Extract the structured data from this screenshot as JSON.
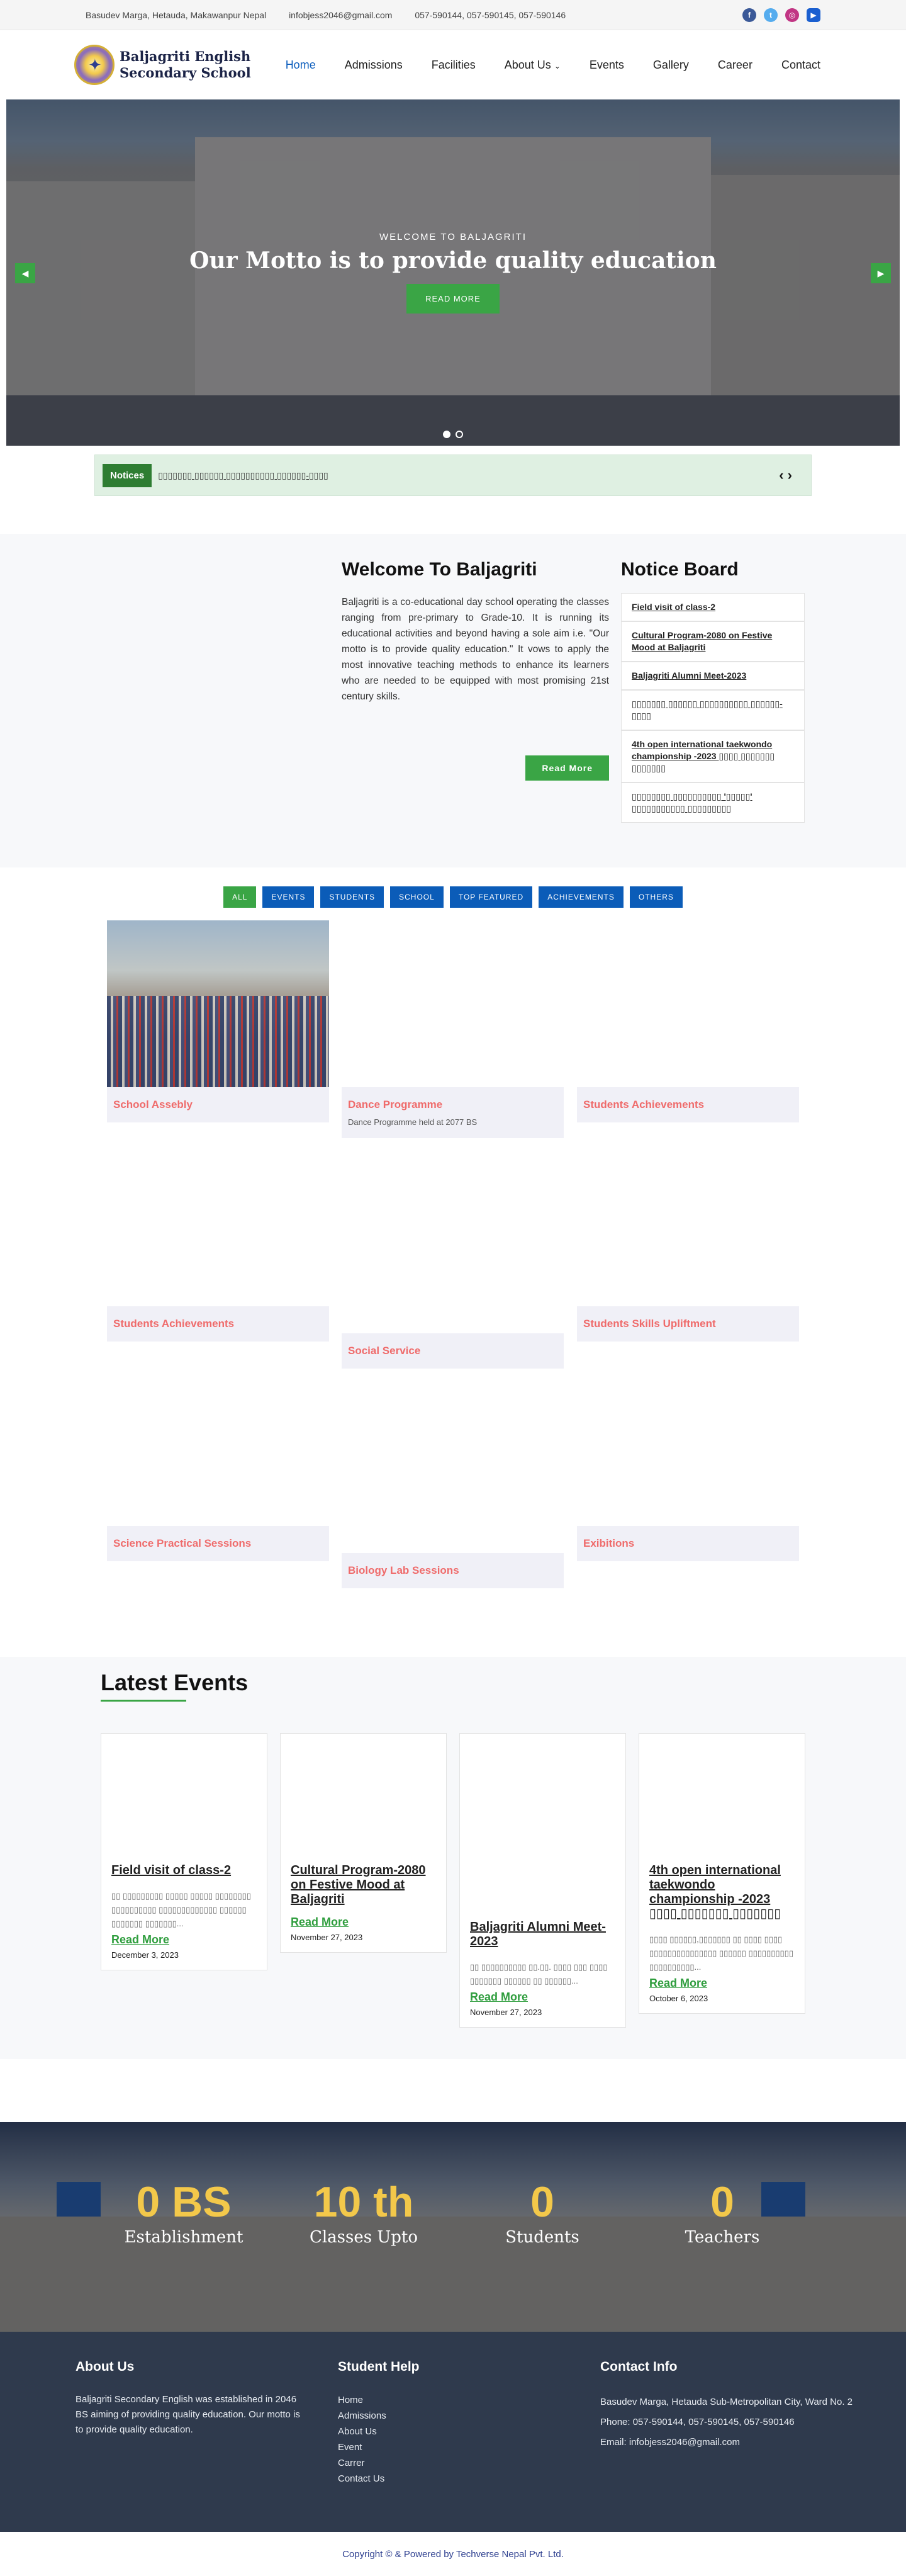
{
  "topbar": {
    "address": "Basudev Marga, Hetauda, Makawanpur Nepal",
    "email": "infobjess2046@gmail.com",
    "phone": "057-590144, 057-590145, 057-590146",
    "socials": [
      {
        "icon": "facebook-icon",
        "color": "#3b5998"
      },
      {
        "icon": "twitter-icon",
        "color": "#55acee"
      },
      {
        "icon": "instagram-icon",
        "color": "#c13584"
      },
      {
        "icon": "youtube-icon",
        "color": "#1a5fd0"
      }
    ]
  },
  "header": {
    "logo_line1": "Baljagriti English",
    "logo_line2": "Secondary School",
    "nav": [
      "Home",
      "Admissions",
      "Facilities",
      "About Us",
      "Events",
      "Gallery",
      "Career",
      "Contact"
    ]
  },
  "hero": {
    "subtitle": "WELCOME TO BALJAGRITI",
    "title": "Our Motto is to provide quality education",
    "button": "READ MORE",
    "prev_arrow": "◀",
    "next_arrow": "▶"
  },
  "notices": {
    "label": "Notices",
    "text": "▯▯▯▯▯▯▯ ▯▯▯▯▯▯ ▯▯▯▯▯▯▯▯▯▯ ▯▯▯▯▯▯-▯▯▯▯",
    "arrows": "‹ ›"
  },
  "welcome": {
    "title": "Welcome To Baljagriti",
    "body": "Baljagriti is a co-educational day school operating the classes ranging from pre-primary to Grade-10. It is running its educational activities and beyond having a sole aim i.e. \"Our motto is to provide quality education.\" It vows to apply the most innovative teaching methods to enhance its learners who are needed to be equipped with most promising 21st century skills.",
    "button": "Read More"
  },
  "notice_board": {
    "title": "Notice Board",
    "items": [
      "Field visit of class-2",
      "Cultural Program-2080 on Festive Mood at Baljagriti",
      "Baljagriti Alumni Meet-2023",
      "▯▯▯▯▯▯▯ ▯▯▯▯▯▯ ▯▯▯▯▯▯▯▯▯▯ ▯▯▯▯▯▯-▯▯▯▯",
      "4th open international taekwondo championship -2023 ▯▯▯▯ ▯▯▯▯▯▯▯ ▯▯▯▯▯▯▯",
      "▯▯▯▯▯▯▯▯ ▯▯▯▯▯▯▯▯▯▯ '▯▯▯▯▯' ▯▯▯▯▯▯▯▯▯▯▯ ▯▯▯▯▯▯▯▯▯"
    ]
  },
  "filters": [
    "ALL",
    "EVENTS",
    "STUDENTS",
    "SCHOOL",
    "TOP FEATURED",
    "ACHIEVEMENTS",
    "OTHERS"
  ],
  "gallery": [
    {
      "title": "School Assebly",
      "desc": ""
    },
    {
      "title": "Dance Programme",
      "desc": "Dance Programme held at 2077 BS"
    },
    {
      "title": "Students Achievements",
      "desc": ""
    },
    {
      "title": "Students Achievements",
      "desc": ""
    },
    {
      "title": "Social Service",
      "desc": ""
    },
    {
      "title": "Students Skills Upliftment",
      "desc": ""
    },
    {
      "title": "Science Practical Sessions",
      "desc": ""
    },
    {
      "title": "Biology Lab Sessions",
      "desc": ""
    },
    {
      "title": "Exibitions",
      "desc": ""
    }
  ],
  "events": {
    "title": "Latest Events",
    "read_more": "Read More",
    "items": [
      {
        "title": "Field visit of class-2",
        "desc": "▯▯ ▯▯▯▯▯▯▯▯▯ ▯▯▯▯▯ ▯▯▯▯▯ ▯▯▯▯▯▯▯▯ ▯▯▯▯▯▯▯▯▯▯ ▯▯▯▯▯▯▯▯▯▯▯▯▯ ▯▯▯▯▯▯ ▯▯▯▯▯▯▯ ▯▯▯▯▯▯▯...",
        "date": "December 3, 2023"
      },
      {
        "title": "Cultural Program-2080 on Festive Mood at Baljagriti",
        "desc": "",
        "date": "November 27, 2023"
      },
      {
        "title": "Baljagriti Alumni Meet-2023",
        "desc": "▯▯ ▯▯▯▯▯▯▯▯▯▯ ▯▯.▯▯. ▯▯▯▯ ▯▯▯ ▯▯▯▯ ▯▯▯▯▯▯▯ ▯▯▯▯▯▯ ▯▯ ▯▯▯▯▯▯...",
        "date": "November 27, 2023"
      },
      {
        "title": "4th open international taekwondo championship -2023 ▯▯▯▯ ▯▯▯▯▯▯▯ ▯▯▯▯▯▯▯",
        "desc": "▯▯▯▯ ▯▯▯▯▯▯,▯▯▯▯▯▯▯ ▯▯ ▯▯▯▯ ▯▯▯▯ ▯▯▯▯▯▯▯▯▯▯▯▯▯▯▯ ▯▯▯▯▯▯ ▯▯▯▯▯▯▯▯▯▯ ▯▯▯▯▯▯▯▯▯▯...",
        "date": "October 6, 2023"
      }
    ]
  },
  "stats": [
    {
      "value": "0 BS",
      "label": "Establishment"
    },
    {
      "value": "10 th",
      "label": "Classes Upto"
    },
    {
      "value": "0",
      "label": "Students"
    },
    {
      "value": "0",
      "label": "Teachers"
    }
  ],
  "footer": {
    "about_title": "About Us",
    "about_text": "Baljagriti Secondary English was established in 2046 BS aiming of providing quality education. Our motto is to provide quality education.",
    "help_title": "Student Help",
    "help_links": [
      "Home",
      "Admissions",
      "About Us",
      "Event",
      "Carrer",
      "Contact Us"
    ],
    "contact_title": "Contact Info",
    "contact_address": "Basudev Marga, Hetauda Sub-Metropolitan City, Ward No. 2",
    "contact_phone": "Phone: 057-590144, 057-590145, 057-590146",
    "contact_email": "Email: infobjess2046@gmail.com"
  },
  "copyright": "Copyright © &  Powered by Techverse Nepal Pvt. Ltd."
}
